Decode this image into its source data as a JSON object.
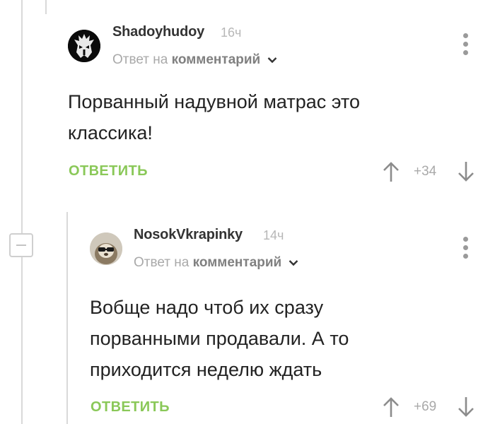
{
  "comments": [
    {
      "author": "Shadoyhudoy",
      "time": "16ч",
      "reply_prefix": "Ответ на",
      "reply_target": "комментарий",
      "text_lines": [
        "Порванный надувной матрас это",
        "классика!"
      ],
      "reply_label": "ОТВЕТИТЬ",
      "rating": "+34"
    },
    {
      "author": "NosokVkrapinky",
      "time": "14ч",
      "reply_prefix": "Ответ на",
      "reply_target": "комментарий",
      "text_lines": [
        "Вобще надо чтоб их сразу",
        "порванными продавали. А то",
        "приходится неделю ждать"
      ],
      "reply_label": "ОТВЕТИТЬ",
      "rating": "+69"
    }
  ],
  "icons": {
    "upvote": "arrow-up-icon",
    "downvote": "arrow-down-icon",
    "more": "more-vertical-icon",
    "collapse": "minus-icon",
    "dropdown": "chevron-down-icon"
  },
  "colors": {
    "reply_green": "#8ac858",
    "thread_line": "#d9d9d9",
    "meta_gray": "#a9a9a9"
  }
}
